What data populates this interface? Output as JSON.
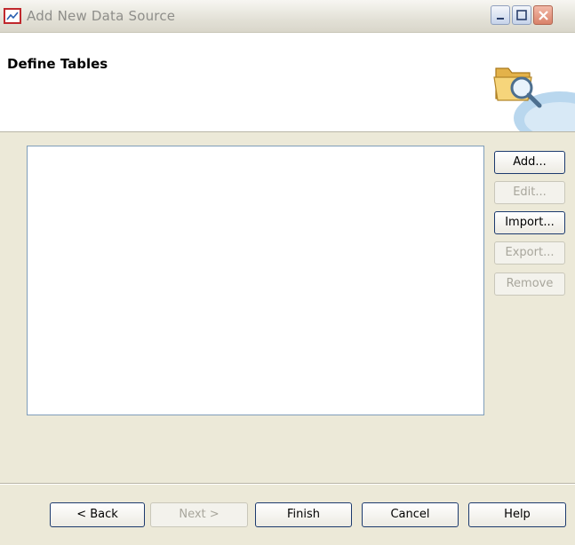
{
  "window": {
    "title": "Add New Data Source",
    "icon": "chart-icon",
    "controls": [
      "minimize-icon",
      "maximize-icon",
      "close-icon"
    ]
  },
  "header": {
    "title": "Define Tables",
    "graphic": "folder-magnifier-icon"
  },
  "tables_list": {
    "items": []
  },
  "side_buttons": {
    "add": "Add...",
    "edit": "Edit...",
    "import": "Import...",
    "export": "Export...",
    "remove": "Remove"
  },
  "footer_buttons": {
    "back": "< Back",
    "next": "Next >",
    "finish": "Finish",
    "cancel": "Cancel",
    "help": "Help"
  },
  "colors": {
    "accent_border": "#1c3a6e",
    "disabled_text": "#a8a69c",
    "dialog_background": "#ece9d8"
  }
}
